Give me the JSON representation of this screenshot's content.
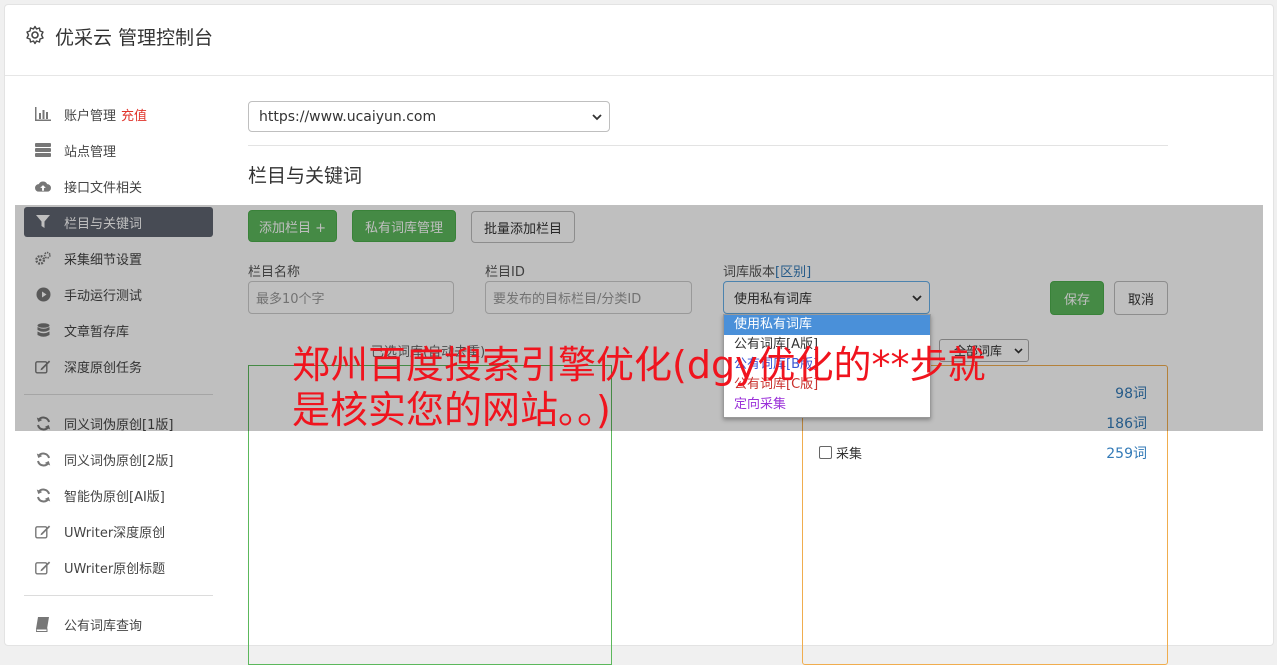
{
  "header": {
    "title": "优采云 管理控制台"
  },
  "sidebar": {
    "items": [
      {
        "label": "账户管理",
        "badge": "充值",
        "icon": "bar-chart-icon"
      },
      {
        "label": "站点管理",
        "icon": "server-icon"
      },
      {
        "label": "接口文件相关",
        "icon": "cloud-upload-icon"
      },
      {
        "label": "栏目与关键词",
        "icon": "filter-icon",
        "active": true
      },
      {
        "label": "采集细节设置",
        "icon": "gears-icon"
      },
      {
        "label": "手动运行测试",
        "icon": "play-circle-icon"
      },
      {
        "label": "文章暂存库",
        "icon": "database-icon"
      },
      {
        "label": "深度原创任务",
        "icon": "edit-icon"
      },
      {
        "label": "同义词伪原创[1版]",
        "icon": "refresh-icon"
      },
      {
        "label": "同义词伪原创[2版]",
        "icon": "refresh-icon"
      },
      {
        "label": "智能伪原创[AI版]",
        "icon": "refresh-icon"
      },
      {
        "label": "UWriter深度原创",
        "icon": "edit-icon"
      },
      {
        "label": "UWriter原创标题",
        "icon": "edit-icon"
      },
      {
        "label": "公有词库查询",
        "icon": "book-icon"
      }
    ]
  },
  "main": {
    "site_select_value": "https://www.ucaiyun.com",
    "section_title": "栏目与关键词",
    "buttons": {
      "add_column": "添加栏目 +",
      "private_lib": "私有词库管理",
      "batch_add": "批量添加栏目",
      "save": "保存",
      "cancel": "取消"
    },
    "form": {
      "column_name_label": "栏目名称",
      "column_name_placeholder": "最多10个字",
      "column_id_label": "栏目ID",
      "column_id_placeholder": "要发布的目标栏目/分类ID",
      "lib_version_label": "词库版本",
      "lib_version_link": "[区别]",
      "lib_version_value": "使用私有词库"
    },
    "dropdown_options": [
      {
        "label": "使用私有词库",
        "color": "#ffffff",
        "bg": "#4a90d9"
      },
      {
        "label": "公有词库[A版]",
        "color": "#333333"
      },
      {
        "label": "公有词库[B版]",
        "color": "#3a56d4"
      },
      {
        "label": "公有词库[C版]",
        "color": "#c9302c"
      },
      {
        "label": "定向采集",
        "color": "#9b30d9"
      }
    ],
    "selected_label": "已选词库(自动去重)",
    "lib_filter_value": "全部词库",
    "lib_rows": [
      {
        "label": "",
        "count": "98词"
      },
      {
        "label": "",
        "count": "186词"
      },
      {
        "label": "采集",
        "count": "259词"
      }
    ]
  },
  "watermark": "郑州百度搜索引擎优化(dgy优化的**步就是核实您的网站。。)"
}
